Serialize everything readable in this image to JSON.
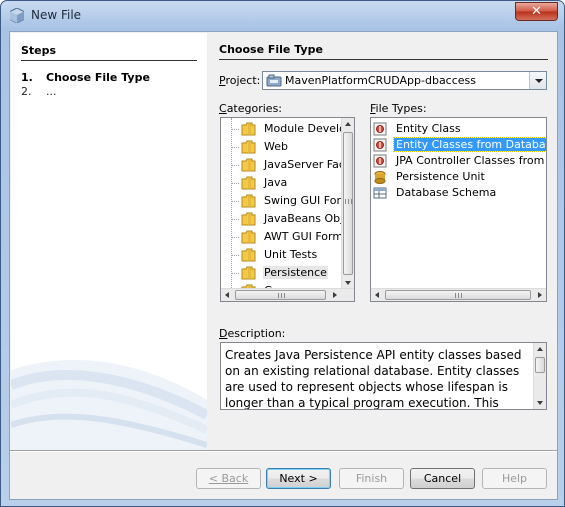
{
  "window": {
    "title": "New File",
    "close_glyph": "✕"
  },
  "steps": {
    "heading": "Steps",
    "items": [
      {
        "num": "1.",
        "label": "Choose File Type"
      },
      {
        "num": "2.",
        "label": "..."
      }
    ]
  },
  "pane": {
    "heading": "Choose File Type",
    "project_label_u": "P",
    "project_label_rest": "roject:",
    "project_value": "MavenPlatformCRUDApp-dbaccess",
    "categories_label_u": "C",
    "categories_label_rest": "ategories:",
    "file_types_label_u": "F",
    "file_types_label_rest": "ile Types:",
    "description_label_u": "D",
    "description_label_rest": "escription:",
    "categories": [
      {
        "label": "Module Develop",
        "icon": "folder-icon"
      },
      {
        "label": "Web",
        "icon": "folder-icon"
      },
      {
        "label": "JavaServer Face",
        "icon": "folder-icon"
      },
      {
        "label": "Java",
        "icon": "folder-icon"
      },
      {
        "label": "Swing GUI Form",
        "icon": "folder-icon"
      },
      {
        "label": "JavaBeans Obje",
        "icon": "folder-icon"
      },
      {
        "label": "AWT GUI Forms",
        "icon": "folder-icon"
      },
      {
        "label": "Unit Tests",
        "icon": "folder-icon"
      },
      {
        "label": "Persistence",
        "icon": "folder-icon",
        "selected": true
      },
      {
        "label": "Groovy",
        "icon": "folder-icon"
      }
    ],
    "file_types": [
      {
        "label": "Entity Class",
        "icon": "entity-class-icon"
      },
      {
        "label": "Entity Classes from Database",
        "icon": "entity-class-icon",
        "selected": true
      },
      {
        "label": "JPA Controller Classes from Entit",
        "icon": "entity-class-icon"
      },
      {
        "label": "Persistence Unit",
        "icon": "persistence-unit-icon"
      },
      {
        "label": "Database Schema",
        "icon": "database-schema-icon"
      }
    ],
    "description": "Creates Java Persistence API entity classes based on an existing relational database. Entity classes are used to represent objects whose lifespan is longer than a typical program execution. This"
  },
  "buttons": {
    "back": "< Back",
    "next": "Next >",
    "finish": "Finish",
    "cancel": "Cancel",
    "help": "Help"
  },
  "colors": {
    "selection": "#3399ff",
    "titlebar": "#a8c3e6"
  }
}
